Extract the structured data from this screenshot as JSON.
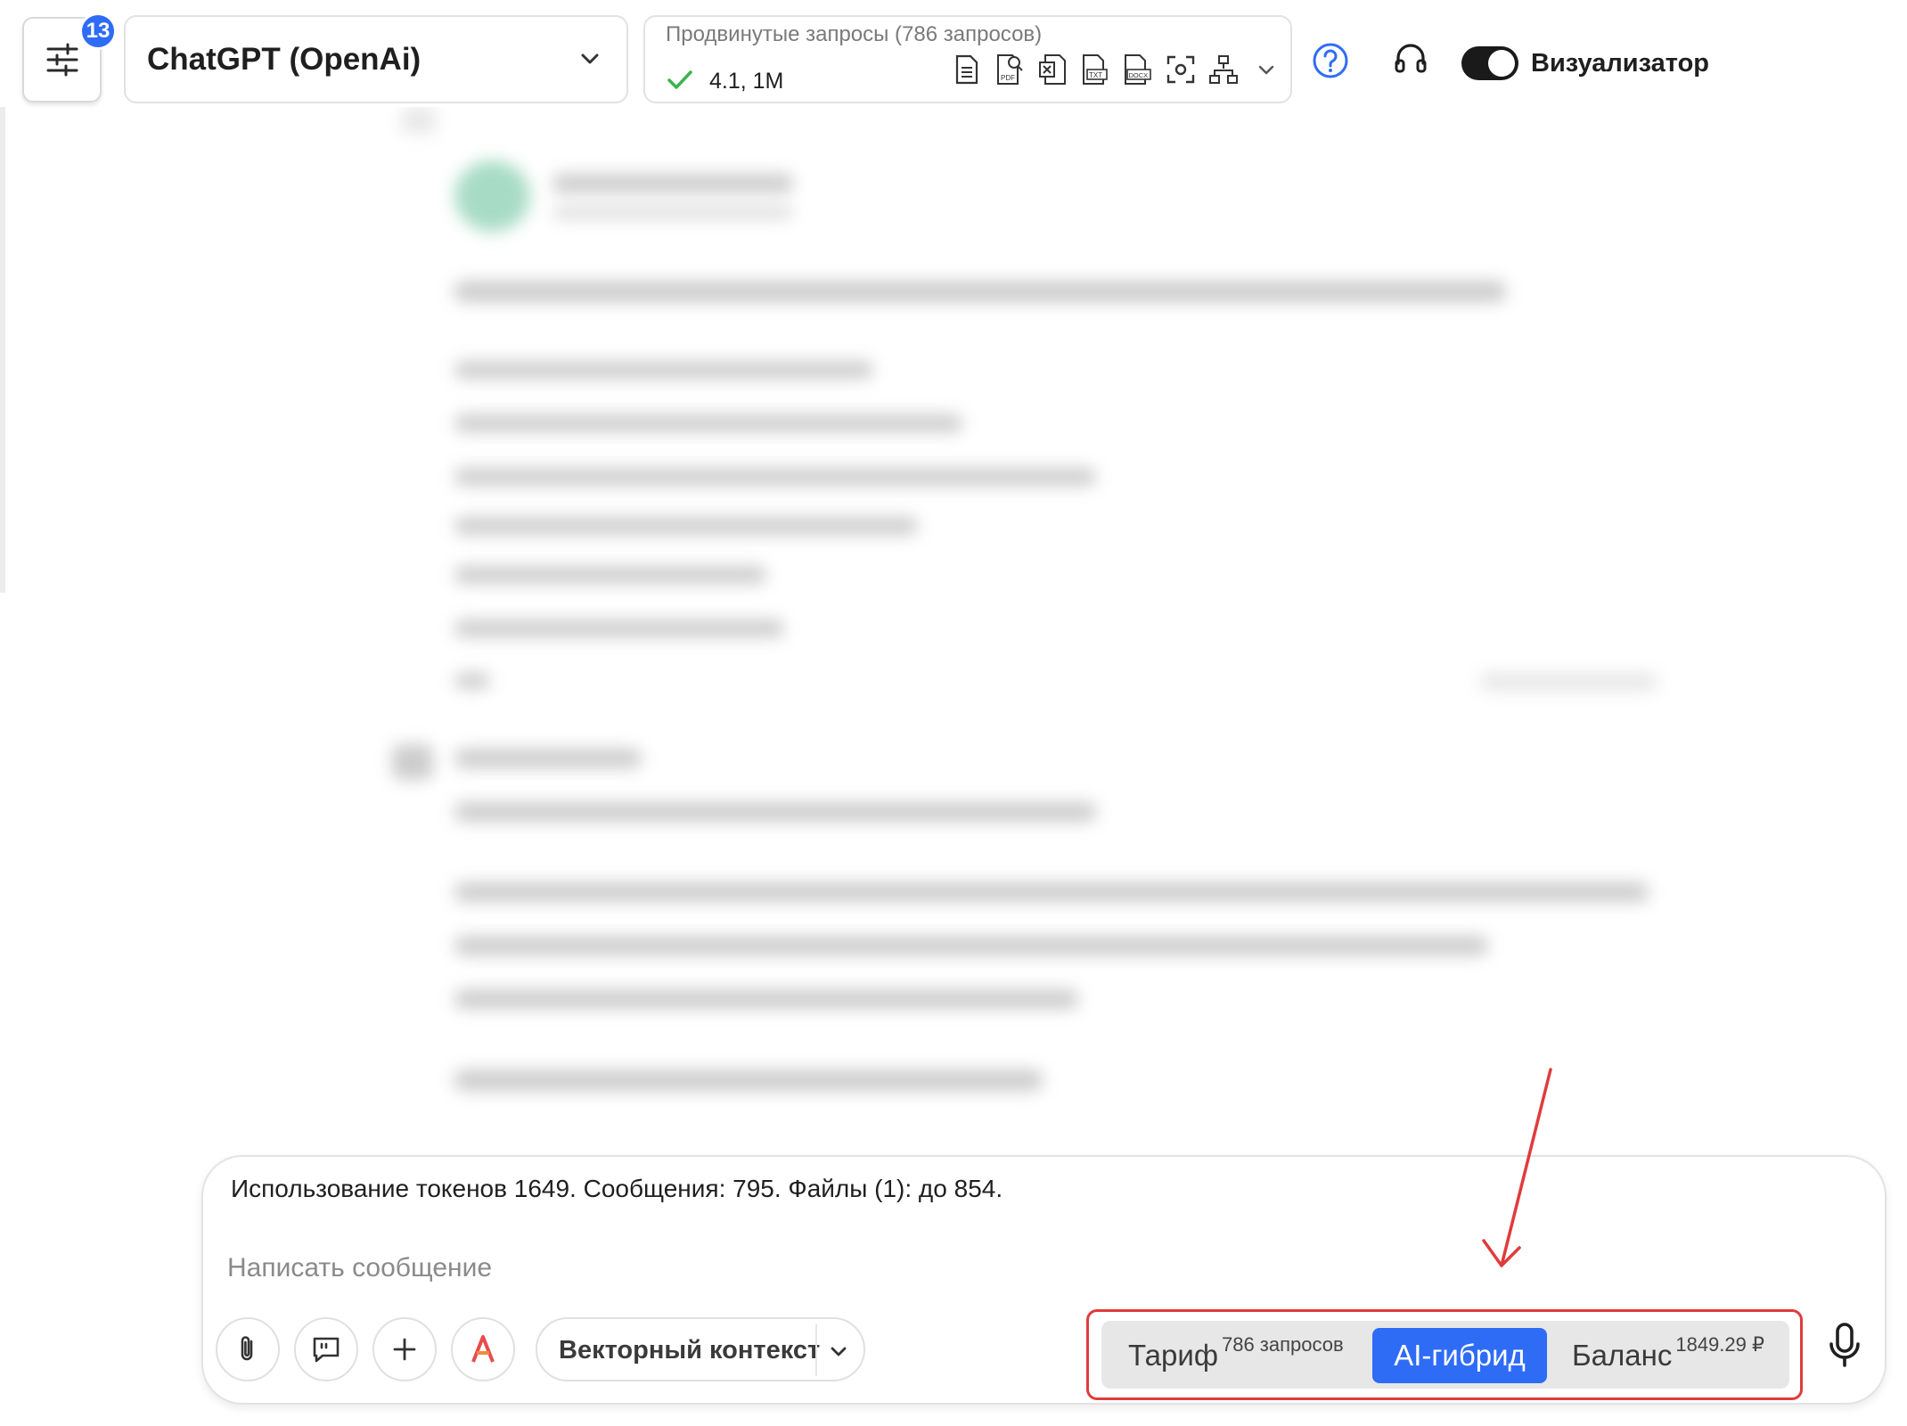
{
  "header": {
    "settings_badge": "13",
    "model": "ChatGPT (OpenAi)",
    "features_title": "Продвинутые запросы (786 запросов)",
    "features_version": "4.1, 1M",
    "feature_icons": [
      "document-icon",
      "pdf-search-icon",
      "excel-icon",
      "txt-file-icon",
      "docx-file-icon",
      "screenshot-icon",
      "sitemap-icon"
    ],
    "visualizer_label": "Визуализатор",
    "visualizer_on": true
  },
  "composer": {
    "token_info": "Использование токенов 1649. Сообщения: 795. Файлы (1): до 854.",
    "placeholder": "Написать сообщение",
    "vector_context_label": "Векторный контекст",
    "modes": {
      "tariff_label": "Тариф",
      "tariff_sup": "786 запросов",
      "hybrid_label": "AI-гибрид",
      "balance_label": "Баланс",
      "balance_sup": "1849.29 ₽",
      "selected": "AI-гибрид"
    }
  },
  "colors": {
    "accent": "#2f6cf6",
    "highlight": "#e03b3b",
    "check": "#3cb34a"
  }
}
